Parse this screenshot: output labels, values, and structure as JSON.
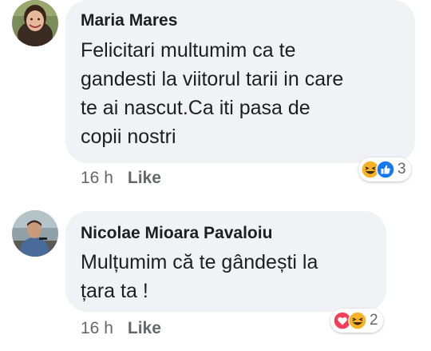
{
  "comments": [
    {
      "author": "Maria Mares",
      "text_lines": [
        "Felicitari multumim ca te",
        "gandesti la viitorul tarii in care",
        "te ai nascut.Ca iti pasa de",
        "copii nostri"
      ],
      "time": "16 h",
      "like_label": "Like",
      "reactions": [
        "haha-icon",
        "like-icon"
      ],
      "reaction_count": "3"
    },
    {
      "author": "Nicolae Mioara Pavaloiu",
      "text_lines": [
        "Mulțumim că te gândești la",
        "țara ta !"
      ],
      "time": "16 h",
      "like_label": "Like",
      "reactions": [
        "love-icon",
        "haha-icon"
      ],
      "reaction_count": "2"
    }
  ],
  "colors": {
    "bubble": "#f0f2f5",
    "meta_text": "#65676b",
    "like_blue": "#1877f2",
    "love_red": "#f33e58",
    "haha_yellow": "#f7b125"
  }
}
